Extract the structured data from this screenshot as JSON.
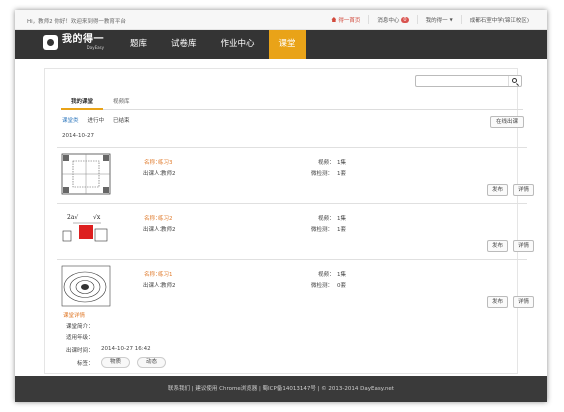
{
  "topbar": {
    "greeting": "Hi，教师2 你好！欢迎来到得一教育平台",
    "home": "得一首页",
    "messages": "消息中心",
    "message_count": "0",
    "user": "我的得一",
    "school": "成都石室中学(锦江校区)"
  },
  "navbar": {
    "logo_main": "我的得一",
    "logo_sub": "DayEasy",
    "items": [
      {
        "label": "题库",
        "active": false
      },
      {
        "label": "试卷库",
        "active": false
      },
      {
        "label": "作业中心",
        "active": false
      },
      {
        "label": "课堂",
        "active": true
      }
    ]
  },
  "search": {
    "placeholder": "",
    "value": ""
  },
  "tabs": [
    {
      "label": "我的课堂",
      "active": true
    },
    {
      "label": "视频库",
      "active": false
    }
  ],
  "filters": [
    {
      "label": "课堂类",
      "active": true
    },
    {
      "label": "进行中",
      "active": false
    },
    {
      "label": "已结束",
      "active": false
    }
  ],
  "publish_online_label": "在线出课",
  "date": "2014-10-27",
  "lesson_labels": {
    "name": "名称：",
    "teacher": "出课人：",
    "video": "视频：",
    "micro": "微检测："
  },
  "lessons": [
    {
      "name": "练习3",
      "teacher": "教师2",
      "video": "1集",
      "micro": "1套",
      "thumb": "grid-figure"
    },
    {
      "name": "练习2",
      "teacher": "教师2",
      "video": "1集",
      "micro": "1套",
      "thumb": "math-figure"
    },
    {
      "name": "练习1",
      "teacher": "教师2",
      "video": "1集",
      "micro": "0套",
      "thumb": "ellipse-figure"
    }
  ],
  "lesson_buttons": {
    "publish": "发布",
    "detail": "详情"
  },
  "details": {
    "title": "课堂详情",
    "intro_label": "课堂简介：",
    "intro": "",
    "grade_label": "适用年级：",
    "grade": "",
    "time_label": "出课时间：",
    "time": "2014-10-27 16:42",
    "tags_label": "标签：",
    "tags": [
      "物质",
      "动态"
    ]
  },
  "footer": "联系我们 | 建议使用 Chrome浏览器 | 蜀ICP备14013147号 | © 2013-2014 DayEasy.net",
  "colors": {
    "accent": "#e9a318",
    "navbar": "#343434",
    "link": "#3a7fc1",
    "orange_text": "#e07b2c",
    "badge": "#d9534f"
  }
}
